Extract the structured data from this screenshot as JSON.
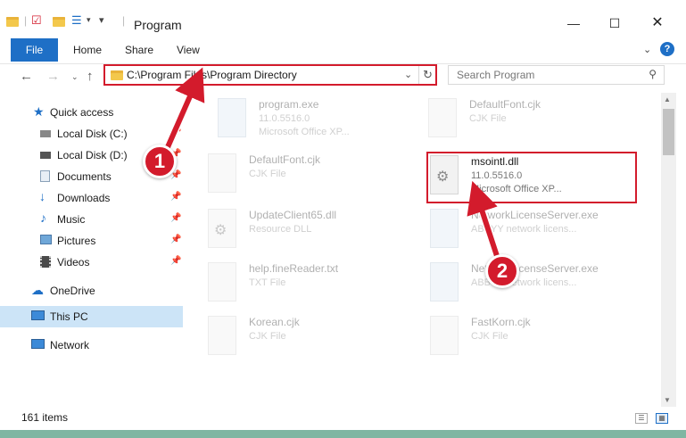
{
  "window": {
    "title": "Program"
  },
  "ribbon": {
    "file_label": "File",
    "tabs": [
      "Home",
      "Share",
      "View"
    ]
  },
  "address": {
    "path": "C:\\Program Files\\Program Directory"
  },
  "search": {
    "placeholder": "Search Program"
  },
  "sidebar": {
    "items": [
      {
        "label": "Quick access",
        "icon": "star-icon"
      },
      {
        "label": "Local Disk (C:)",
        "icon": "drive-icon"
      },
      {
        "label": "Local Disk (D:)",
        "icon": "drive-icon"
      },
      {
        "label": "Documents",
        "icon": "documents-icon"
      },
      {
        "label": "Downloads",
        "icon": "download-icon"
      },
      {
        "label": "Music",
        "icon": "music-icon"
      },
      {
        "label": "Pictures",
        "icon": "pictures-icon"
      },
      {
        "label": "Videos",
        "icon": "videos-icon"
      },
      {
        "label": "OneDrive",
        "icon": "cloud-icon"
      },
      {
        "label": "This PC",
        "icon": "computer-icon",
        "selected": true
      },
      {
        "label": "Network",
        "icon": "network-icon"
      }
    ]
  },
  "files": [
    {
      "name": "program.exe",
      "line2": "11.0.5516.0",
      "line3": "Microsoft Office XP...",
      "kind": "exe"
    },
    {
      "name": "DefaultFont.cjk",
      "line2": "CJK File",
      "line3": "",
      "kind": "doc"
    },
    {
      "name": "DefaultFont.cjk",
      "line2": "CJK File",
      "line3": "",
      "kind": "doc"
    },
    {
      "name": "msointl.dll",
      "line2": "11.0.5516.0",
      "line3": "Microsoft Office XP...",
      "kind": "dll"
    },
    {
      "name": "UpdateClient65.dll",
      "line2": "Resource DLL",
      "line3": "",
      "kind": "dll"
    },
    {
      "name": "NetworkLicenseServer.exe",
      "line2": "ABBYY network licens...",
      "line3": "",
      "kind": "exe"
    },
    {
      "name": "help.fineReader.txt",
      "line2": "TXT File",
      "line3": "",
      "kind": "doc"
    },
    {
      "name": "NetworkLicenseServer.exe",
      "line2": "ABBYY network licens...",
      "line3": "",
      "kind": "exe"
    },
    {
      "name": "Korean.cjk",
      "line2": "CJK File",
      "line3": "",
      "kind": "doc"
    },
    {
      "name": "FastKorn.cjk",
      "line2": "CJK File",
      "line3": "",
      "kind": "doc"
    }
  ],
  "callouts": [
    "1",
    "2"
  ],
  "status": {
    "items_text": "161 items"
  },
  "colors": {
    "accent": "#1e6fc6",
    "highlight": "#d31b2c",
    "selection": "#cce4f7"
  }
}
